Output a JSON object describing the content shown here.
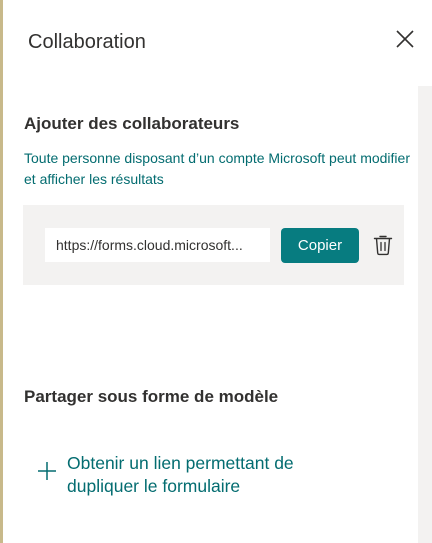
{
  "panel": {
    "title": "Collaboration",
    "close_icon": "close-icon"
  },
  "collaborators": {
    "heading": "Ajouter des collaborateurs",
    "description": "Toute personne disposant d’un compte Microsoft peut modifier et afficher les résultats",
    "link_value": "https://forms.cloud.microsoft...",
    "copy_label": "Copier",
    "delete_icon": "trash-icon"
  },
  "template": {
    "heading": "Partager sous forme de modèle",
    "link_label": "Obtenir un lien permettant de dupliquer le formulaire",
    "link_icon": "plus-icon"
  },
  "colors": {
    "accent": "#077c80",
    "link_text": "#036c70",
    "box_background": "#f3f2f1"
  }
}
